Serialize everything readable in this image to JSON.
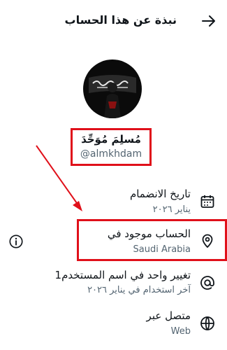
{
  "header": {
    "title": "نبذة عن هذا الحساب"
  },
  "profile": {
    "display_name": "مُسلِمَ مُوَحِّدَ",
    "username": "@almkhdam"
  },
  "rows": [
    {
      "id": "joined",
      "title": "تاريخ الانضمام",
      "subtitle": "يناير ٢٠٢٦",
      "icon": "calendar-icon"
    },
    {
      "id": "location",
      "title": "الحساب موجود في",
      "subtitle": "Saudi Arabia",
      "icon": "location-pin-icon"
    },
    {
      "id": "username-change",
      "title": "تغيير واحد في اسم المستخدم1",
      "subtitle": "آخر استخدام في يناير ٢٠٢٦",
      "icon": "at-sign-icon"
    },
    {
      "id": "connected-via",
      "title": "متصل عبر",
      "subtitle": "Web",
      "icon": "globe-icon"
    }
  ],
  "colors": {
    "highlight": "#e0101a",
    "secondary_text": "#536471",
    "primary_text": "#0f1419"
  }
}
